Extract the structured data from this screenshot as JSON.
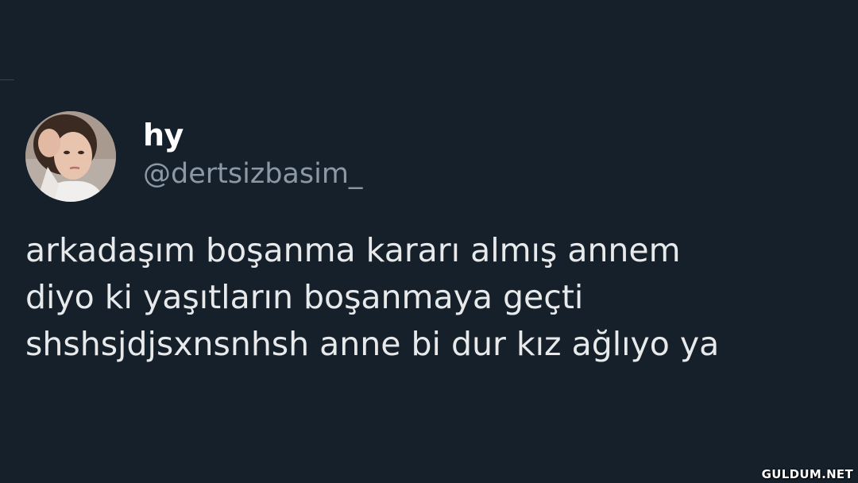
{
  "tweet": {
    "display_name": "hy",
    "username": "@dertsizbasim_",
    "avatar_icon": "profile-photo",
    "text": "arkadaşım boşanma kararı almış annem\ndiyo ki yaşıtların boşanmaya geçti\nshshsjdjsxnsnhsh anne bi dur kız ağlıyo ya"
  },
  "watermark": "GULDUM.NET",
  "colors": {
    "background": "#15202b",
    "display_name": "#ffffff",
    "username": "#8b98a5",
    "text": "#e7e9ea"
  }
}
